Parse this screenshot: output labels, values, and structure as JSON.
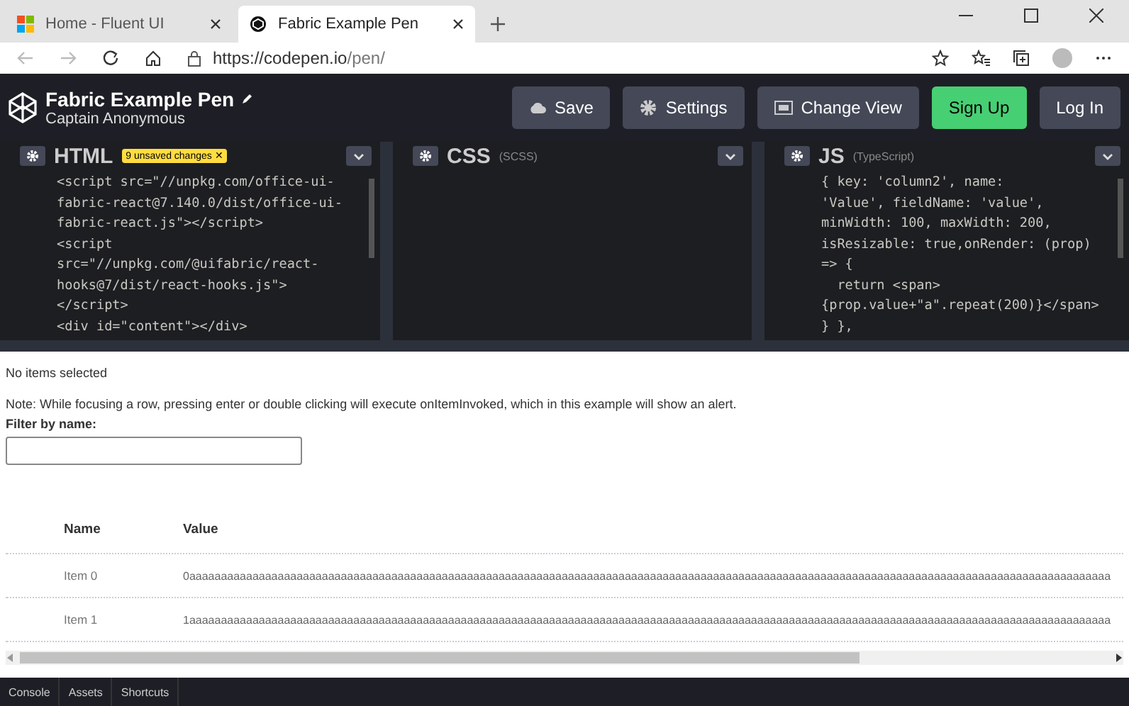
{
  "browser": {
    "tabs": [
      {
        "title": "Home - Fluent UI",
        "selected": false
      },
      {
        "title": "Fabric Example Pen",
        "selected": true
      }
    ],
    "url": {
      "host": "https://codepen.io",
      "path": "/pen/"
    }
  },
  "header": {
    "title": "Fabric Example Pen",
    "author": "Captain Anonymous",
    "buttons": [
      {
        "label": "Save",
        "primary": false
      },
      {
        "label": "Settings",
        "primary": false
      },
      {
        "label": "Change View",
        "primary": false
      },
      {
        "label": "Sign Up",
        "primary": true
      },
      {
        "label": "Log In",
        "primary": false
      }
    ]
  },
  "editors": [
    {
      "name": "HTML",
      "badge": "9 unsaved changes ✕",
      "lines": [
        "<script src=\"//unpkg.com/office-ui-",
        "fabric-react@7.140.0/dist/office-ui-",
        "fabric-react.js\"></script>",
        "<script",
        "src=\"//unpkg.com/@uifabric/react-",
        "hooks@7/dist/react-hooks.js\">",
        "</script>",
        "<div id=\"content\"></div>"
      ]
    },
    {
      "name": "CSS",
      "note": "(SCSS)"
    },
    {
      "name": "JS",
      "note": "(TypeScript)",
      "lines": [
        "{ key: 'column2', name:",
        "'Value', fieldName: 'value',",
        "minWidth: 100, maxWidth: 200,",
        "isResizable: true,onRender: (prop)",
        "=> {",
        "  return <span>",
        "{prop.value+\"a\".repeat(200)}</span>",
        "} },"
      ]
    }
  ],
  "result": {
    "status": "No items selected",
    "note": "Note: While focusing a row, pressing enter or double clicking will execute onItemInvoked, which in this example will show an alert.",
    "filter_label": "Filter by name:",
    "table": {
      "columns": [
        "Name",
        "Value"
      ],
      "rows": [
        [
          "Item 0",
          "0aaaaaaaaaaaaaaaaaaaaaaaaaaaaaaaaaaaaaaaaaaaaaaaaaaaaaaaaaaaaaaaaaaaaaaaaaaaaaaaaaaaaaaaaaaaaaaaaaaaaaaaaaaaaaaaaaaaaaaaaaaaaaaaaaaaaaaaaaaaaaaaaaa"
        ],
        [
          "Item 1",
          "1aaaaaaaaaaaaaaaaaaaaaaaaaaaaaaaaaaaaaaaaaaaaaaaaaaaaaaaaaaaaaaaaaaaaaaaaaaaaaaaaaaaaaaaaaaaaaaaaaaaaaaaaaaaaaaaaaaaaaaaaaaaaaaaaaaaaaaaaaaaaaaaaaa"
        ]
      ]
    }
  },
  "footer": {
    "tabs": [
      "Console",
      "Assets",
      "Shortcuts"
    ]
  }
}
